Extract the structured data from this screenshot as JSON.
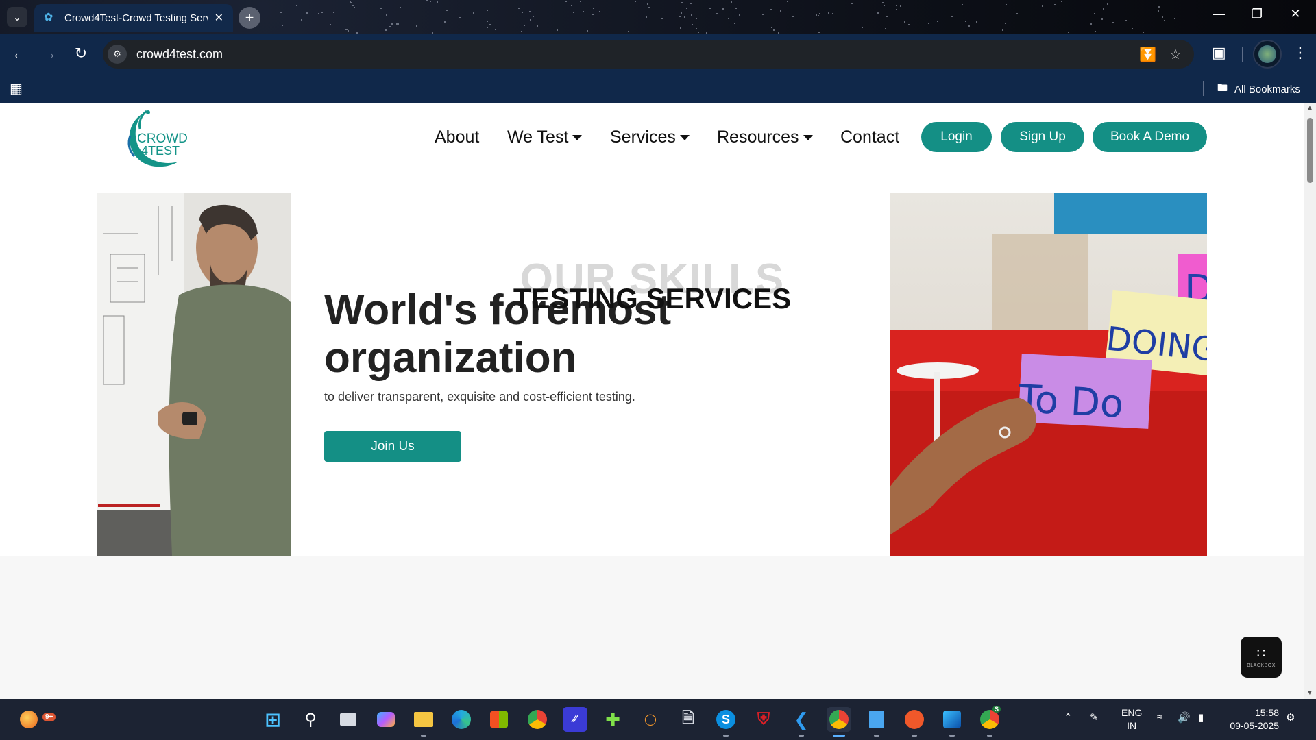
{
  "browser": {
    "tab": {
      "title": "Crowd4Test-Crowd Testing Serv"
    },
    "url": "crowd4test.com",
    "bookmarks_label": "All Bookmarks"
  },
  "site": {
    "logo": {
      "line1": "CROWD",
      "line2": "4TEST"
    },
    "nav": [
      {
        "label": "About"
      },
      {
        "label": "We Test"
      },
      {
        "label": "Services"
      },
      {
        "label": "Resources"
      },
      {
        "label": "Contact"
      }
    ],
    "buttons": {
      "login": "Login",
      "signup": "Sign Up",
      "demo": "Book A Demo"
    },
    "hero": {
      "title_line1": "World's foremost",
      "title_line2": "organization",
      "subtitle": "to deliver transparent, exquisite and cost-efficient testing.",
      "cta": "Join Us",
      "sticky_doing": "DOING",
      "sticky_todo": "To Do",
      "sticky_d": "D"
    },
    "skills": {
      "background_text": "OUR SKILLS",
      "title": "TESTING SERVICES"
    },
    "widget": {
      "label": "BLACKBOX"
    }
  },
  "taskbar": {
    "notification_badge": "9+",
    "language": [
      "ENG",
      "IN"
    ],
    "time": "15:58",
    "date": "09-05-2025",
    "skype_badge": "S"
  },
  "colors": {
    "brand": "#148f85",
    "browser_bar": "#10284a",
    "taskbar": "#1c2333"
  }
}
